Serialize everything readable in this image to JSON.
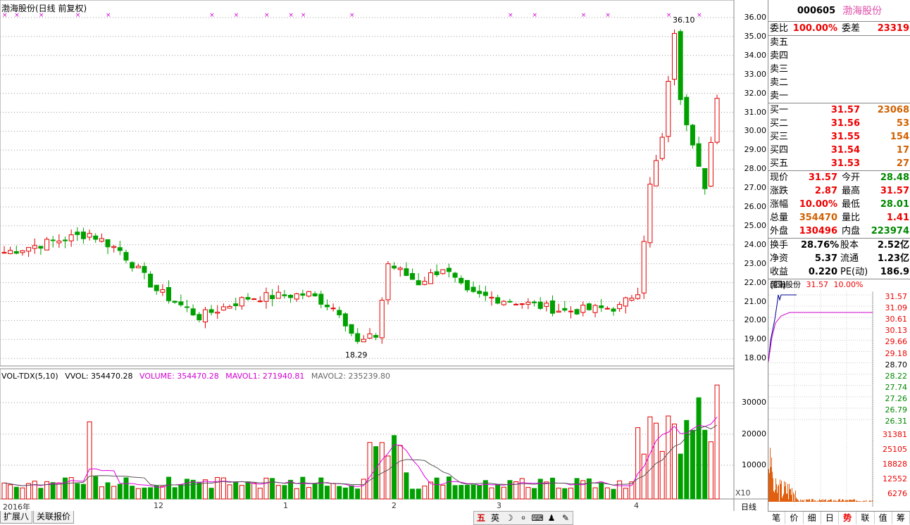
{
  "title": "渤海股份(日线 前复权)",
  "volume_legend": {
    "indicator": "VOL-TDX(5,10)",
    "vvol": "VVOL: 354470.28",
    "volume": "VOLUME: 354470.28",
    "mavol1": "MAVOL1: 271940.81",
    "mavol2": "MAVOL2: 235239.80"
  },
  "annotations": {
    "high": "36.10",
    "low": "18.29"
  },
  "price_axis": [
    "36.00",
    "35.00",
    "34.00",
    "33.00",
    "32.00",
    "31.00",
    "30.00",
    "29.00",
    "28.00",
    "27.00",
    "26.00",
    "25.00",
    "24.00",
    "23.00",
    "22.00",
    "21.00",
    "20.00",
    "19.00",
    "18.00"
  ],
  "volume_axis": [
    "30000",
    "20000",
    "10000"
  ],
  "volume_scale": "X10",
  "period_label": "日线",
  "date_labels": [
    "2016年",
    "12",
    "1",
    "2",
    "3",
    "4"
  ],
  "bottom_tabs": [
    "扩展八",
    "关联报价"
  ],
  "ime_icons": [
    "五",
    "英",
    "☽",
    "⸰",
    "⌨",
    "♟",
    "✎"
  ],
  "colors": {
    "up": "#e00000",
    "down": "#00a000",
    "ma1": "#e000e0",
    "ma2": "#000080"
  },
  "panel": {
    "code": "000605",
    "name": "渤海股份",
    "weibi_label": "委比",
    "weibi": "100.00%",
    "weicha_label": "委差",
    "weicha": "23319",
    "sell": [
      {
        "label": "卖五",
        "price": "",
        "vol": ""
      },
      {
        "label": "卖四",
        "price": "",
        "vol": ""
      },
      {
        "label": "卖三",
        "price": "",
        "vol": ""
      },
      {
        "label": "卖二",
        "price": "",
        "vol": ""
      },
      {
        "label": "卖一",
        "price": "",
        "vol": ""
      }
    ],
    "buy": [
      {
        "label": "买一",
        "price": "31.57",
        "vol": "23068"
      },
      {
        "label": "买二",
        "price": "31.56",
        "vol": "53"
      },
      {
        "label": "买三",
        "price": "31.55",
        "vol": "154"
      },
      {
        "label": "买四",
        "price": "31.54",
        "vol": "17"
      },
      {
        "label": "买五",
        "price": "31.53",
        "vol": "27"
      }
    ],
    "stats1": [
      {
        "l1": "现价",
        "v1": "31.57",
        "c1": "red",
        "l2": "今开",
        "v2": "28.48",
        "c2": "grn"
      },
      {
        "l1": "涨跌",
        "v1": "2.87",
        "c1": "red",
        "l2": "最高",
        "v2": "31.57",
        "c2": "red"
      },
      {
        "l1": "涨幅",
        "v1": "10.00%",
        "c1": "red",
        "l2": "最低",
        "v2": "28.01",
        "c2": "grn"
      },
      {
        "l1": "总量",
        "v1": "354470",
        "c1": "org",
        "l2": "量比",
        "v2": "1.41",
        "c2": "red"
      },
      {
        "l1": "外盘",
        "v1": "130496",
        "c1": "red",
        "l2": "内盘",
        "v2": "223974",
        "c2": "grn"
      }
    ],
    "stats2": [
      {
        "l1": "换手",
        "v1": "28.76%",
        "l2": "股本",
        "v2": "2.52亿"
      },
      {
        "l1": "净资",
        "v1": "5.37",
        "l2": "流通",
        "v2": "1.23亿"
      },
      {
        "l1": "收益(四)",
        "v1": "0.220",
        "l2": "PE(动)",
        "v2": "186.9"
      }
    ],
    "mini_name": "渤海股份",
    "mini_price": "31.57",
    "mini_pct": "10.00%",
    "mini_axis": [
      "31.57",
      "31.09",
      "30.61",
      "30.13",
      "29.66",
      "29.18",
      "28.70",
      "28.22",
      "27.74",
      "27.26",
      "26.79",
      "26.31"
    ],
    "mini_vol_axis": [
      "31381",
      "25105",
      "18828",
      "12552",
      "6276"
    ],
    "tabs": [
      "笔",
      "价",
      "细",
      "日",
      "势",
      "联",
      "值",
      "筹"
    ],
    "active_tab": "势"
  }
}
